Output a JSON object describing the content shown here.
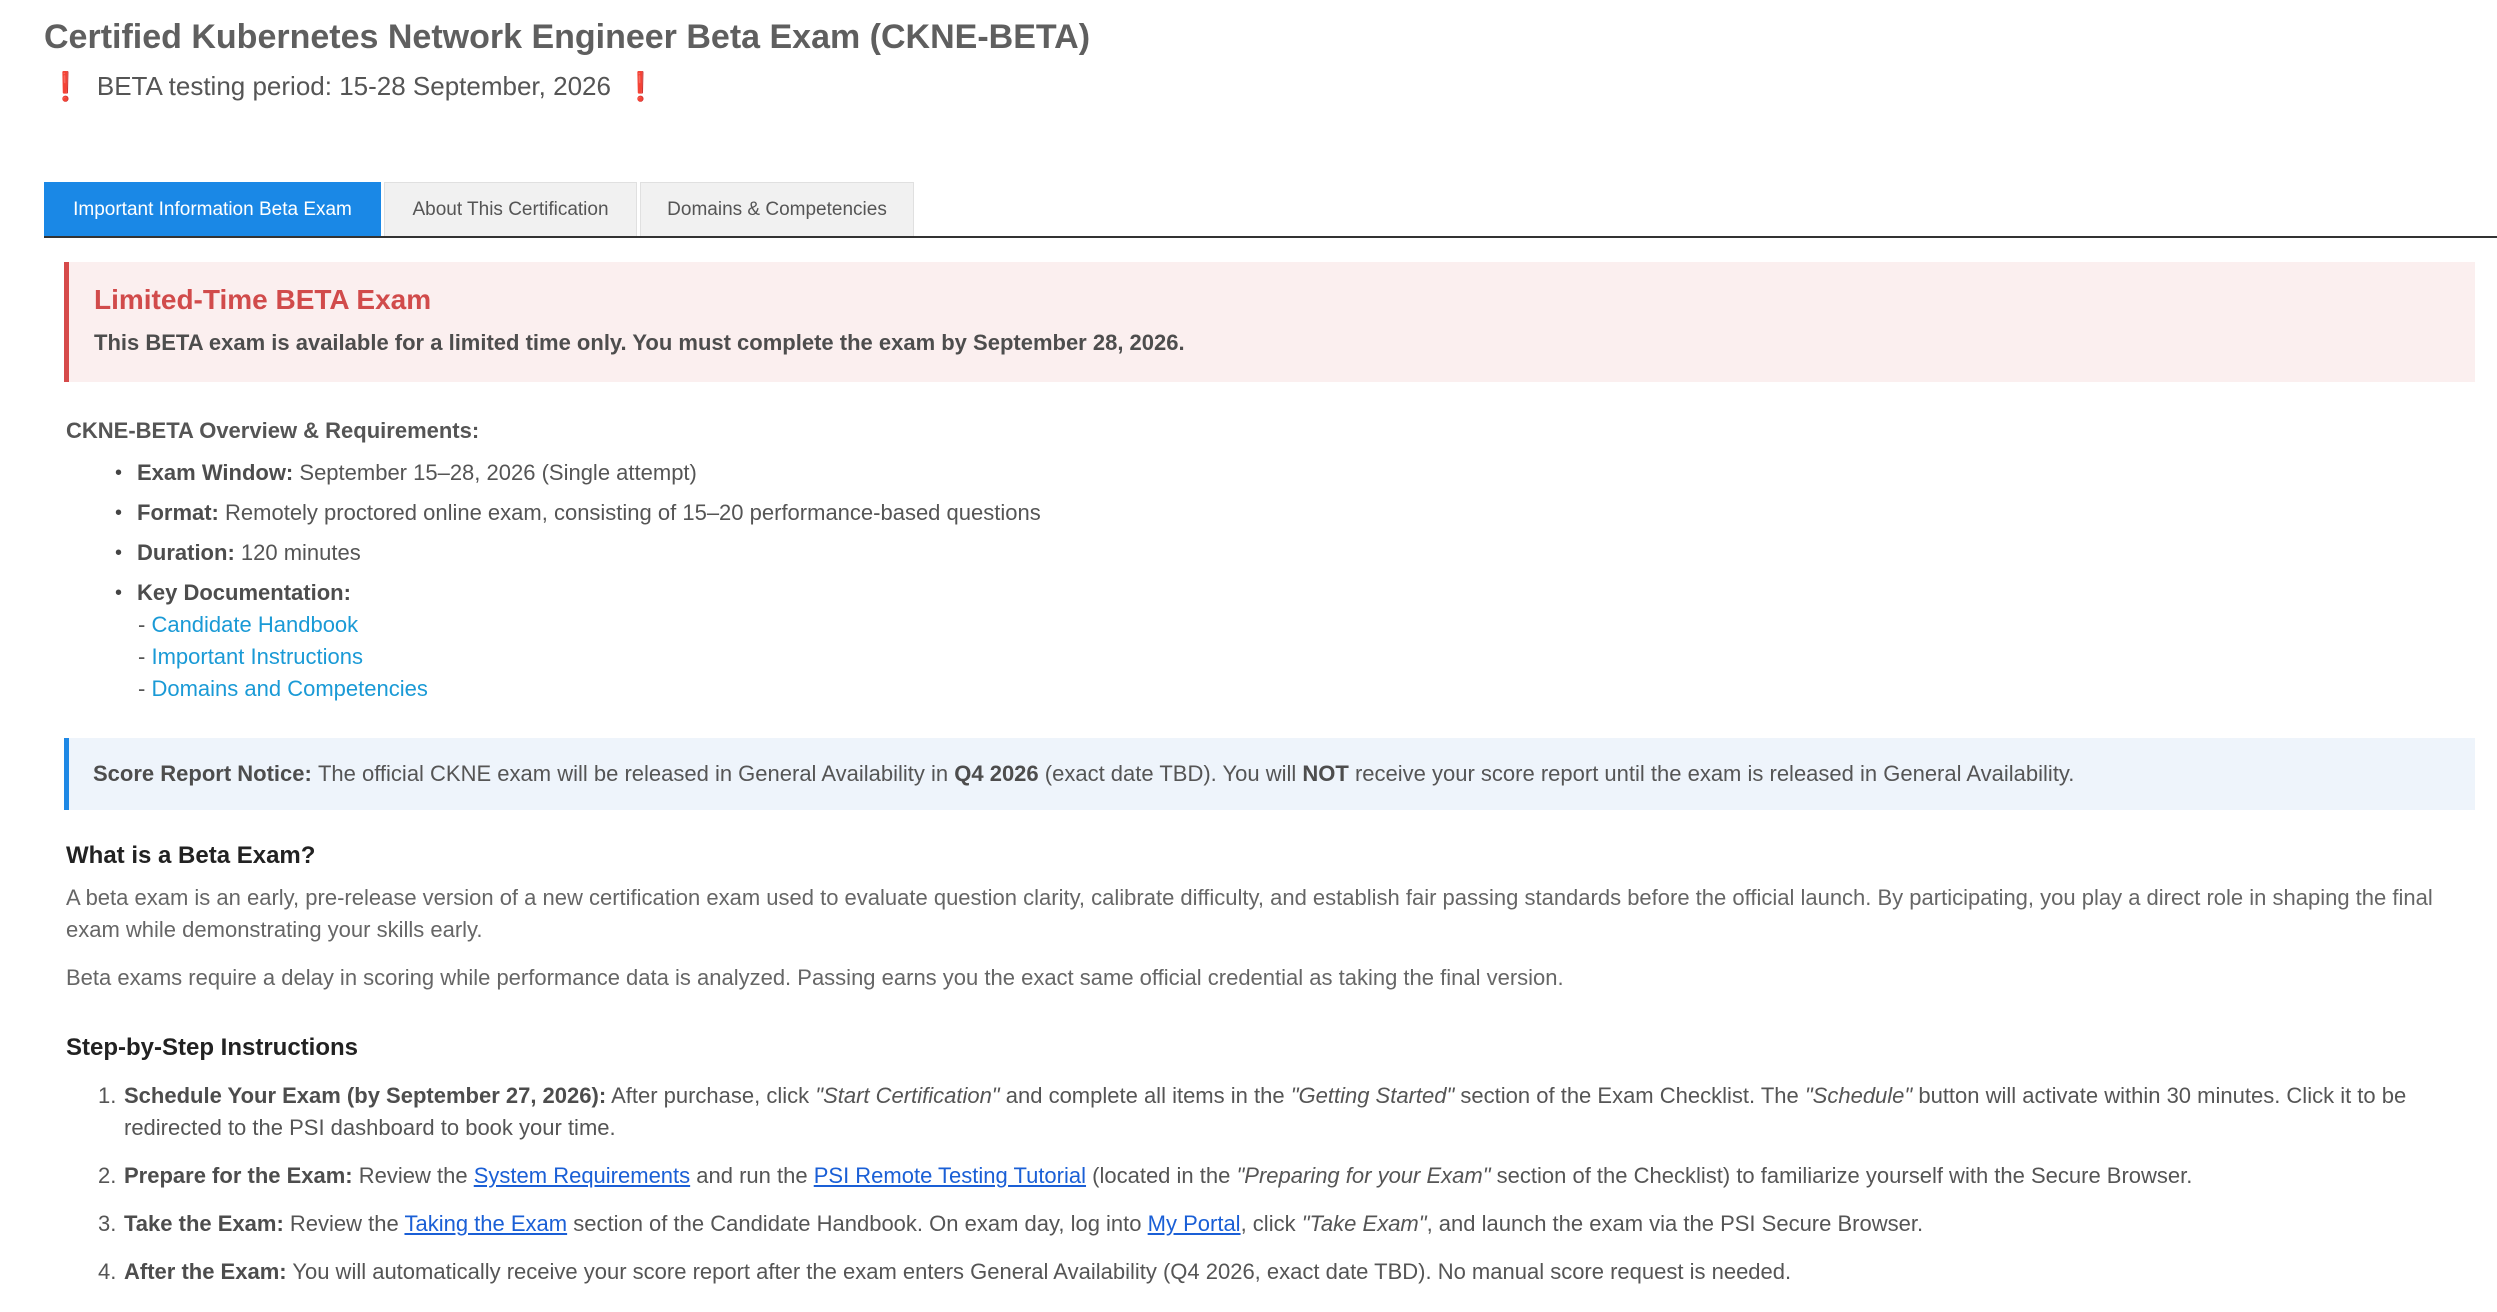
{
  "header": {
    "title": "Certified Kubernetes Network Engineer Beta Exam (CKNE-BETA)",
    "subtitle": "BETA testing period: 15-28 September, 2026",
    "icon_left": "exclamation-icon",
    "icon_right": "exclamation-icon"
  },
  "tabs": [
    {
      "label": "Important Information Beta Exam",
      "active": true
    },
    {
      "label": "About This Certification",
      "active": false
    },
    {
      "label": "Domains & Competencies",
      "active": false
    }
  ],
  "alert": {
    "title": "Limited-Time BETA Exam",
    "body": "This BETA exam is available for a limited time only. You must complete the exam by September 28, 2026."
  },
  "overview": {
    "heading": "CKNE-BETA Overview & Requirements:",
    "items": [
      {
        "label": "Exam Window:",
        "value": "September 15–28, 2026 (Single attempt)"
      },
      {
        "label": "Format:",
        "value": "Remotely proctored online exam, consisting of 15–20 performance-based questions"
      },
      {
        "label": "Duration:",
        "value": "120 minutes"
      },
      {
        "label": "Key Documentation:",
        "value": ""
      }
    ],
    "doc_prefix": "-",
    "docs": [
      "Candidate Handbook",
      "Important Instructions",
      "Domains and Competencies"
    ]
  },
  "notice": {
    "label": "Score Report Notice:",
    "text1": "The official CKNE exam will be released in General Availability in",
    "bold1": "Q4 2026",
    "text2": "(exact date TBD). You will",
    "bold2": "NOT",
    "text3": "receive your score report until the exam is released in General Availability."
  },
  "beta": {
    "heading": "What is a Beta Exam?",
    "p1": "A beta exam is an early, pre-release version of a new certification exam used to evaluate question clarity, calibrate difficulty, and establish fair passing standards before the official launch. By participating, you play a direct role in shaping the final exam while demonstrating your skills early.",
    "p2": "Beta exams require a delay in scoring while performance data is analyzed. Passing earns you the exact same official credential as taking the final version."
  },
  "steps": {
    "heading": "Step-by-Step Instructions",
    "s1": {
      "num": "1.",
      "label": "Schedule Your Exam (by September 27, 2026):",
      "t1": "After purchase, click",
      "i1": "\"Start Certification\"",
      "t2": "and complete all items in the",
      "i2": "\"Getting Started\"",
      "t3": "section of the Exam Checklist. The",
      "i3": "\"Schedule\"",
      "t4": "button will activate within 30 minutes. Click it to be redirected to the PSI dashboard to book your time."
    },
    "s2": {
      "num": "2.",
      "label": "Prepare for the Exam:",
      "t1": "Review the",
      "l1": "System Requirements",
      "t2": "and run the",
      "l2": "PSI Remote Testing Tutorial",
      "t3": "(located in the",
      "i1": "\"Preparing for your Exam\"",
      "t4": "section of the Checklist) to familiarize yourself with the Secure Browser."
    },
    "s3": {
      "num": "3.",
      "label": "Take the Exam:",
      "t1": "Review the",
      "l1": "Taking the Exam",
      "t2": "section of the Candidate Handbook. On exam day, log into",
      "l2": "My Portal",
      "t3": ", click",
      "i1": "\"Take Exam\"",
      "t4": ", and launch the exam via the PSI Secure Browser."
    },
    "s4": {
      "num": "4.",
      "label": "After the Exam:",
      "t1": "You will automatically receive your score report after the exam enters General Availability (Q4 2026, exact date TBD). No manual score request is needed."
    }
  }
}
